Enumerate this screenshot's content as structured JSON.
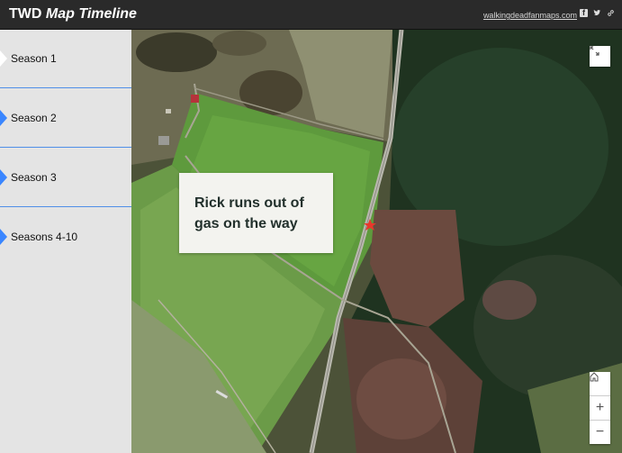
{
  "header": {
    "title_main": "TWD",
    "title_sub": "Map Timeline",
    "site_link": "walkingdeadfanmaps.com",
    "icons": [
      "facebook-icon",
      "twitter-icon",
      "link-icon"
    ]
  },
  "sidebar": {
    "items": [
      {
        "label": "Season 1",
        "active": true
      },
      {
        "label": "Season 2",
        "active": false
      },
      {
        "label": "Season 3",
        "active": false
      },
      {
        "label": "Seasons 4-10",
        "active": false
      }
    ]
  },
  "map": {
    "popup_text": "Rick runs out of gas on the way",
    "marker_icon": "star-marker-icon",
    "controls": {
      "expand": "expand-icon",
      "home": "home-icon",
      "zoom_in": "+",
      "zoom_out": "−"
    }
  },
  "colors": {
    "header_bg": "#2a2a2a",
    "sidebar_bg": "#e4e4e4",
    "accent_blue": "#3a86ff",
    "marker_red": "#e8382c"
  }
}
